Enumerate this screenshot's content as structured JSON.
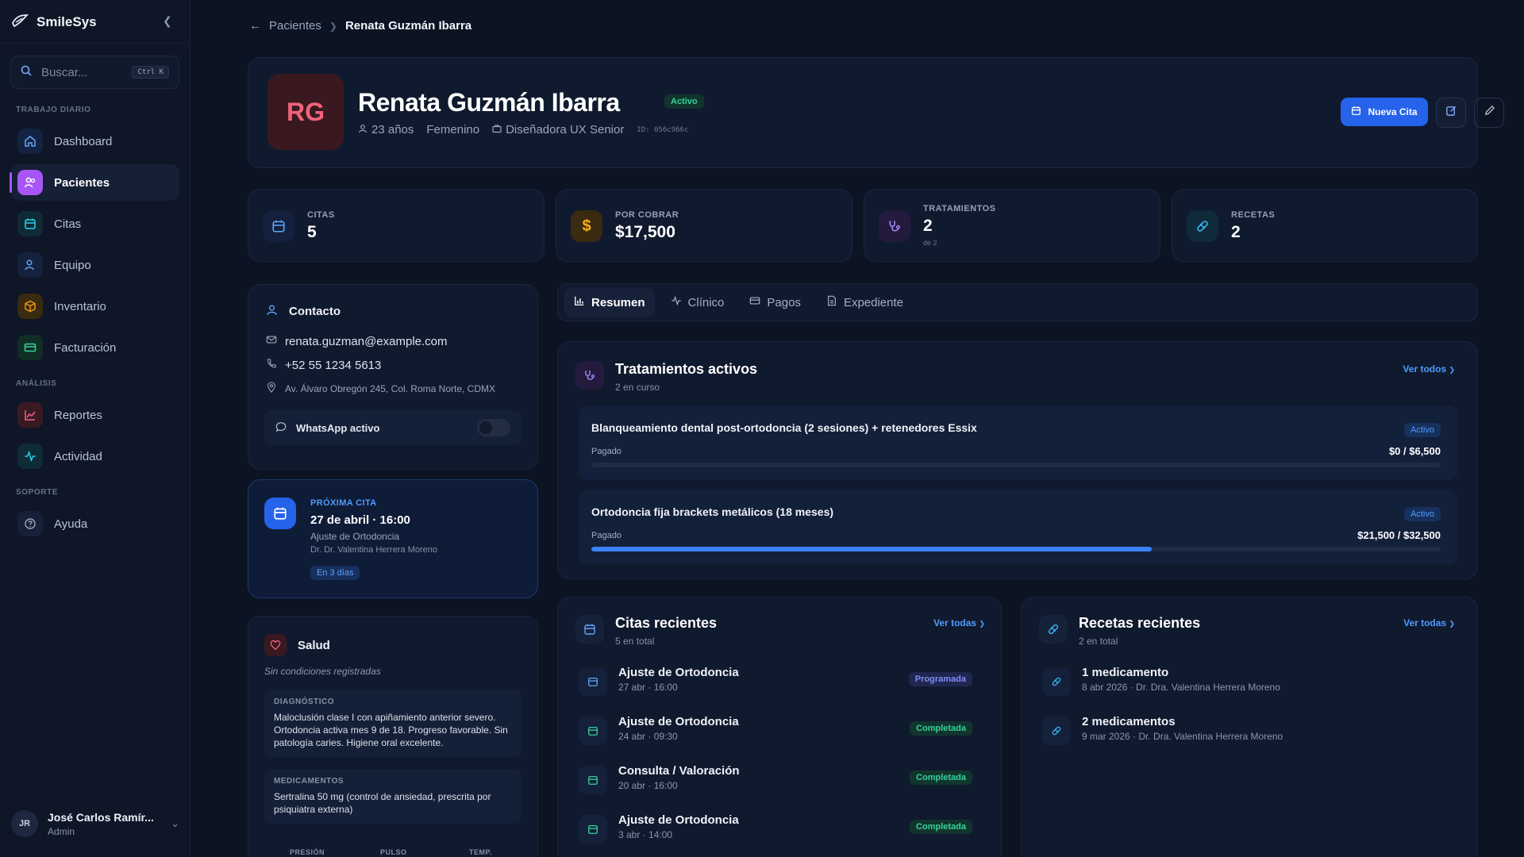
{
  "app": {
    "name": "SmileSys"
  },
  "search": {
    "placeholder": "Buscar...",
    "shortcut": "Ctrl K"
  },
  "sidebar": {
    "sections": [
      {
        "label": "TRABAJO DIARIO"
      },
      {
        "label": "ANÁLISIS"
      },
      {
        "label": "SOPORTE"
      }
    ],
    "items": [
      {
        "label": "Dashboard"
      },
      {
        "label": "Pacientes"
      },
      {
        "label": "Citas"
      },
      {
        "label": "Equipo"
      },
      {
        "label": "Inventario"
      },
      {
        "label": "Facturación"
      },
      {
        "label": "Reportes"
      },
      {
        "label": "Actividad"
      },
      {
        "label": "Ayuda"
      }
    ],
    "user": {
      "initials": "JR",
      "name": "José Carlos Ramír...",
      "role": "Admin"
    }
  },
  "breadcrumb": {
    "parent": "Pacientes",
    "current": "Renata Guzmán Ibarra"
  },
  "patient": {
    "initials": "RG",
    "name": "Renata Guzmán Ibarra",
    "status": "Activo",
    "age": "23 años",
    "gender": "Femenino",
    "occupation": "Diseñadora UX Senior",
    "id": "ID: 056c966c"
  },
  "actions": {
    "new_appt": "Nueva Cita"
  },
  "stats": [
    {
      "label": "CITAS",
      "value": "5",
      "sub": ""
    },
    {
      "label": "POR COBRAR",
      "value": "$17,500",
      "sub": ""
    },
    {
      "label": "TRATAMIENTOS",
      "value": "2",
      "sub": "de 2"
    },
    {
      "label": "RECETAS",
      "value": "2",
      "sub": ""
    }
  ],
  "contact": {
    "title": "Contacto",
    "email": "renata.guzman@example.com",
    "phone": "+52 55 1234 5613",
    "address": "Av. Álvaro Obregón 245, Col. Roma Norte, CDMX",
    "whatsapp": "WhatsApp activo"
  },
  "next_appt": {
    "label": "PRÓXIMA CITA",
    "date": "27 de abril · 16:00",
    "type": "Ajuste de Ortodoncia",
    "doctor": "Dr. Dr. Valentina Herrera Moreno",
    "in": "En 3 días"
  },
  "health": {
    "title": "Salud",
    "conditions": "Sin condiciones registradas",
    "diag_label": "DIAGNÓSTICO",
    "diag_text": "Maloclusión clase I con apiñamiento anterior severo. Ortodoncia activa mes 9 de 18. Progreso favorable. Sin patología caries. Higiene oral excelente.",
    "meds_label": "MEDICAMENTOS",
    "meds_text": "Sertralina 50 mg (control de ansiedad, prescrita por psiquiatra externa)",
    "vitals": [
      "PRESIÓN",
      "PULSO",
      "TEMP."
    ]
  },
  "tabs": [
    {
      "label": "Resumen"
    },
    {
      "label": "Clínico"
    },
    {
      "label": "Pagos"
    },
    {
      "label": "Expediente"
    }
  ],
  "treatments": {
    "title": "Tratamientos activos",
    "sub": "2 en curso",
    "link": "Ver todos",
    "items": [
      {
        "name": "Blanqueamiento dental post-ortodoncia (2 sesiones) + retenedores Essix",
        "status": "Activo",
        "paid_label": "Pagado",
        "paid": "$0 / $6,500",
        "progress": 0
      },
      {
        "name": "Ortodoncia fija brackets metálicos (18 meses)",
        "status": "Activo",
        "paid_label": "Pagado",
        "paid": "$21,500 / $32,500",
        "progress": 0.66
      }
    ]
  },
  "appointments": {
    "title": "Citas recientes",
    "sub": "5 en total",
    "link": "Ver todas",
    "items": [
      {
        "title": "Ajuste de Ortodoncia",
        "when": "27 abr · 16:00",
        "status": "Programada"
      },
      {
        "title": "Ajuste de Ortodoncia",
        "when": "24 abr · 09:30",
        "status": "Completada"
      },
      {
        "title": "Consulta / Valoración",
        "when": "20 abr · 16:00",
        "status": "Completada"
      },
      {
        "title": "Ajuste de Ortodoncia",
        "when": "3 abr · 14:00",
        "status": "Completada"
      }
    ]
  },
  "prescriptions": {
    "title": "Recetas recientes",
    "sub": "2 en total",
    "link": "Ver todas",
    "items": [
      {
        "title": "1 medicamento",
        "when": "8 abr 2026 · Dr. Dra. Valentina Herrera Moreno"
      },
      {
        "title": "2 medicamentos",
        "when": "9 mar 2026 · Dr. Dra. Valentina Herrera Moreno"
      }
    ]
  },
  "colors": {
    "accent": "#2563eb",
    "active_nav": "#a855f7",
    "success": "#34d399",
    "danger": "#f0647a"
  }
}
